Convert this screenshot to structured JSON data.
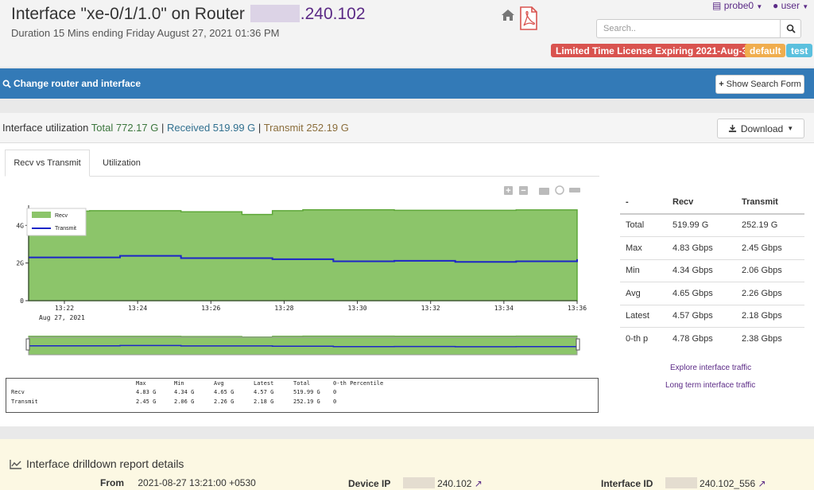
{
  "header": {
    "title_prefix": "Interface \"xe-0/1/1.0\" on Router",
    "title_suffix": ".240.102",
    "subtitle": "Duration 15 Mins ending Friday August 27, 2021 01:36 PM",
    "probe_menu": "probe0",
    "user_menu": "user",
    "search_placeholder": "Search..",
    "badges": [
      {
        "label": "Limited Time License Expiring 2021-Aug-31",
        "color": "#d9534f"
      },
      {
        "label": "default",
        "color": "#f0ad4e"
      },
      {
        "label": "test",
        "color": "#5bc0de"
      }
    ]
  },
  "bluebar": {
    "title": "Change router and interface",
    "show_search_button": "Show Search Form"
  },
  "panel": {
    "util_label": "Interface utilization",
    "total": "Total 772.17 G",
    "received": "Received 519.99 G",
    "transmit": "Transmit 252.19 G",
    "sep": "|",
    "download_button": "Download",
    "tabs": [
      "Recv vs Transmit",
      "Utilization"
    ]
  },
  "chart_data": {
    "type": "area",
    "series": [
      {
        "name": "Recv",
        "color": "#8cc56a",
        "values": [
          4.76,
          4.76,
          4.78,
          4.78,
          4.78,
          4.72,
          4.72,
          4.58,
          4.78,
          4.83,
          4.83,
          4.83,
          4.8,
          4.8,
          4.8,
          4.8,
          4.82,
          4.82,
          4.74
        ]
      },
      {
        "name": "Transmit",
        "color": "#1c25c8",
        "values": [
          2.3,
          2.3,
          2.3,
          2.38,
          2.38,
          2.26,
          2.26,
          2.26,
          2.2,
          2.2,
          2.09,
          2.09,
          2.12,
          2.12,
          2.06,
          2.06,
          2.09,
          2.09,
          2.2
        ]
      },
      {
        "name": "Transmit-end",
        "values": []
      }
    ],
    "x_ticks": [
      "13:22",
      "13:24",
      "13:26",
      "13:28",
      "13:30",
      "13:32",
      "13:34",
      "13:36"
    ],
    "x_date_label": "Aug 27, 2021",
    "y_ticks": [
      "0",
      "2G",
      "4G"
    ],
    "ylim": [
      0,
      6
    ],
    "legend": [
      "Recv",
      "Transmit"
    ]
  },
  "stats": {
    "headers": [
      "Max",
      "Min",
      "Avg",
      "Latest",
      "Total",
      "0-th Percentile"
    ],
    "rows": [
      {
        "name": "Recv",
        "cells": [
          "4.83 G",
          "4.34 G",
          "4.65 G",
          "4.57 G",
          "519.99 G",
          "0"
        ]
      },
      {
        "name": "Transmit",
        "cells": [
          "2.45 G",
          "2.06 G",
          "2.26 G",
          "2.18 G",
          "252.19 G",
          "0"
        ]
      }
    ]
  },
  "right_table": {
    "headers": [
      "-",
      "Recv",
      "Transmit"
    ],
    "rows": [
      [
        "Total",
        "519.99 G",
        "252.19 G"
      ],
      [
        "Max",
        "4.83 Gbps",
        "2.45 Gbps"
      ],
      [
        "Min",
        "4.34 Gbps",
        "2.06 Gbps"
      ],
      [
        "Avg",
        "4.65 Gbps",
        "2.26 Gbps"
      ],
      [
        "Latest",
        "4.57 Gbps",
        "2.18 Gbps"
      ],
      [
        "0-th p",
        "4.78 Gbps",
        "2.38 Gbps"
      ]
    ],
    "link1": "Explore interface traffic",
    "link2": "Long term interface traffic"
  },
  "drilldown": {
    "title": "Interface drilldown report details",
    "from_label": "From",
    "from_value": "2021-08-27 13:21:00 +0530",
    "device_ip_label": "Device IP",
    "device_ip_value": "240.102",
    "interface_id_label": "Interface ID",
    "interface_id_value": "240.102_556"
  }
}
